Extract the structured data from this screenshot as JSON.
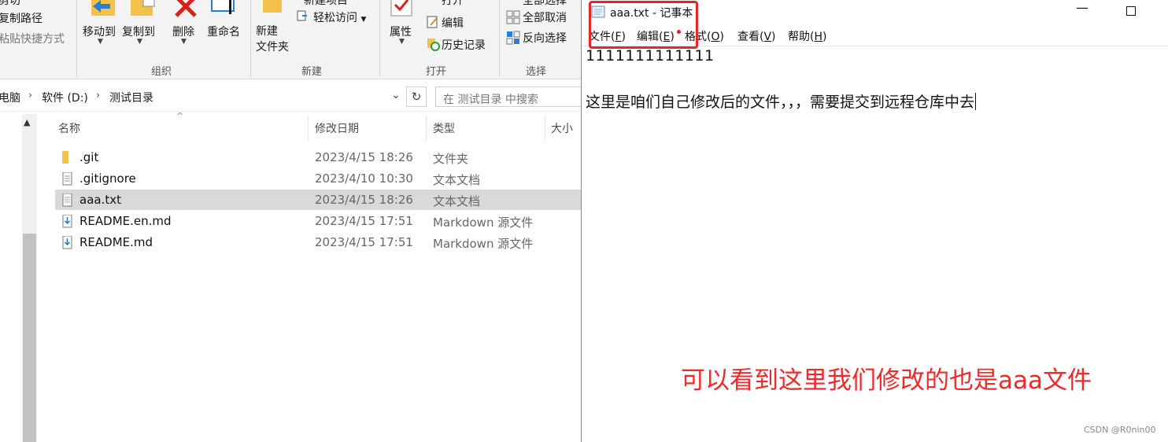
{
  "ribbon": {
    "paste_path": "复制路径",
    "paste_shortcut": "粘贴快捷方式",
    "move_to": "移动到",
    "copy_to": "复制到",
    "delete": "删除",
    "rename": "重命名",
    "new_folder": "新建\n文件夹",
    "easy_access": "轻松访问",
    "properties": "属性",
    "edit": "编辑",
    "history": "历史记录",
    "select_none": "全部取消",
    "invert_selection": "反向选择",
    "groups": {
      "organize": "组织",
      "new": "新建",
      "open": "打开",
      "select": "选择"
    }
  },
  "address": {
    "crumbs": [
      "电脑",
      "软件 (D:)",
      "测试目录"
    ],
    "search_placeholder": "在 测试目录 中搜索"
  },
  "filelist": {
    "columns": {
      "name": "名称",
      "modified": "修改日期",
      "type": "类型",
      "size": "大小"
    },
    "rows": [
      {
        "name": ".git",
        "modified": "2023/4/15 18:26",
        "type": "文件夹",
        "icon": "folder-icon"
      },
      {
        "name": ".gitignore",
        "modified": "2023/4/10 10:30",
        "type": "文本文档",
        "icon": "text-file-icon"
      },
      {
        "name": "aaa.txt",
        "modified": "2023/4/15 18:26",
        "type": "文本文档",
        "icon": "text-file-icon",
        "selected": true
      },
      {
        "name": "README.en.md",
        "modified": "2023/4/15 17:51",
        "type": "Markdown 源文件",
        "icon": "markdown-file-icon"
      },
      {
        "name": "README.md",
        "modified": "2023/4/15 17:51",
        "type": "Markdown 源文件",
        "icon": "markdown-file-icon"
      }
    ]
  },
  "notepad": {
    "title": "aaa.txt - 记事本",
    "menu": [
      {
        "label": "文件(",
        "key": "F",
        "end": ")"
      },
      {
        "label": "编辑(",
        "key": "E",
        "end": ")"
      },
      {
        "label": "格式(",
        "key": "O",
        "end": ")"
      },
      {
        "label": "查看(",
        "key": "V",
        "end": ")"
      },
      {
        "label": "帮助(",
        "key": "H",
        "end": ")"
      }
    ],
    "content_line1": "1111111111111",
    "content_line2": "这里是咱们自己修改后的文件，，，需要提交到远程仓库中去"
  },
  "annotation": "可以看到这里我们修改的也是aaa文件",
  "watermark": "CSDN @R0nin00",
  "colors": {
    "highlight_red": "#e8262a",
    "annotation_red": "#ef2a2a",
    "selection_gray": "#d9d9d9"
  }
}
